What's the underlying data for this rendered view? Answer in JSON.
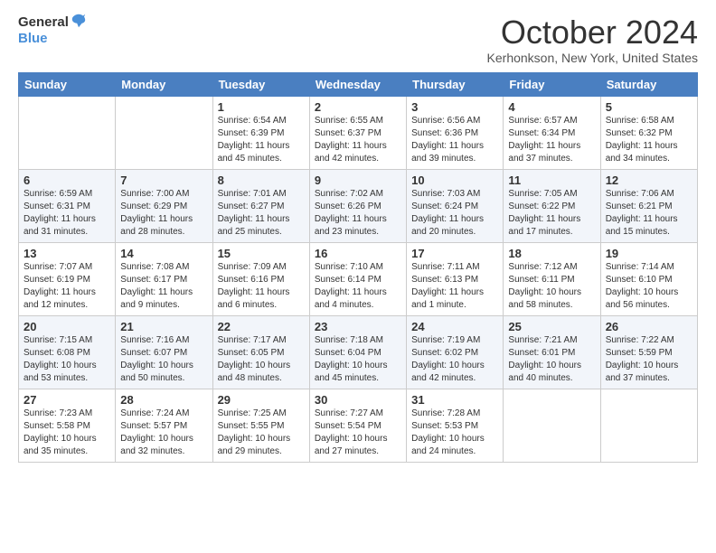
{
  "logo": {
    "line1": "General",
    "line2": "Blue"
  },
  "title": "October 2024",
  "subtitle": "Kerhonkson, New York, United States",
  "weekdays": [
    "Sunday",
    "Monday",
    "Tuesday",
    "Wednesday",
    "Thursday",
    "Friday",
    "Saturday"
  ],
  "weeks": [
    [
      {
        "day": "",
        "detail": ""
      },
      {
        "day": "",
        "detail": ""
      },
      {
        "day": "1",
        "detail": "Sunrise: 6:54 AM\nSunset: 6:39 PM\nDaylight: 11 hours and 45 minutes."
      },
      {
        "day": "2",
        "detail": "Sunrise: 6:55 AM\nSunset: 6:37 PM\nDaylight: 11 hours and 42 minutes."
      },
      {
        "day": "3",
        "detail": "Sunrise: 6:56 AM\nSunset: 6:36 PM\nDaylight: 11 hours and 39 minutes."
      },
      {
        "day": "4",
        "detail": "Sunrise: 6:57 AM\nSunset: 6:34 PM\nDaylight: 11 hours and 37 minutes."
      },
      {
        "day": "5",
        "detail": "Sunrise: 6:58 AM\nSunset: 6:32 PM\nDaylight: 11 hours and 34 minutes."
      }
    ],
    [
      {
        "day": "6",
        "detail": "Sunrise: 6:59 AM\nSunset: 6:31 PM\nDaylight: 11 hours and 31 minutes."
      },
      {
        "day": "7",
        "detail": "Sunrise: 7:00 AM\nSunset: 6:29 PM\nDaylight: 11 hours and 28 minutes."
      },
      {
        "day": "8",
        "detail": "Sunrise: 7:01 AM\nSunset: 6:27 PM\nDaylight: 11 hours and 25 minutes."
      },
      {
        "day": "9",
        "detail": "Sunrise: 7:02 AM\nSunset: 6:26 PM\nDaylight: 11 hours and 23 minutes."
      },
      {
        "day": "10",
        "detail": "Sunrise: 7:03 AM\nSunset: 6:24 PM\nDaylight: 11 hours and 20 minutes."
      },
      {
        "day": "11",
        "detail": "Sunrise: 7:05 AM\nSunset: 6:22 PM\nDaylight: 11 hours and 17 minutes."
      },
      {
        "day": "12",
        "detail": "Sunrise: 7:06 AM\nSunset: 6:21 PM\nDaylight: 11 hours and 15 minutes."
      }
    ],
    [
      {
        "day": "13",
        "detail": "Sunrise: 7:07 AM\nSunset: 6:19 PM\nDaylight: 11 hours and 12 minutes."
      },
      {
        "day": "14",
        "detail": "Sunrise: 7:08 AM\nSunset: 6:17 PM\nDaylight: 11 hours and 9 minutes."
      },
      {
        "day": "15",
        "detail": "Sunrise: 7:09 AM\nSunset: 6:16 PM\nDaylight: 11 hours and 6 minutes."
      },
      {
        "day": "16",
        "detail": "Sunrise: 7:10 AM\nSunset: 6:14 PM\nDaylight: 11 hours and 4 minutes."
      },
      {
        "day": "17",
        "detail": "Sunrise: 7:11 AM\nSunset: 6:13 PM\nDaylight: 11 hours and 1 minute."
      },
      {
        "day": "18",
        "detail": "Sunrise: 7:12 AM\nSunset: 6:11 PM\nDaylight: 10 hours and 58 minutes."
      },
      {
        "day": "19",
        "detail": "Sunrise: 7:14 AM\nSunset: 6:10 PM\nDaylight: 10 hours and 56 minutes."
      }
    ],
    [
      {
        "day": "20",
        "detail": "Sunrise: 7:15 AM\nSunset: 6:08 PM\nDaylight: 10 hours and 53 minutes."
      },
      {
        "day": "21",
        "detail": "Sunrise: 7:16 AM\nSunset: 6:07 PM\nDaylight: 10 hours and 50 minutes."
      },
      {
        "day": "22",
        "detail": "Sunrise: 7:17 AM\nSunset: 6:05 PM\nDaylight: 10 hours and 48 minutes."
      },
      {
        "day": "23",
        "detail": "Sunrise: 7:18 AM\nSunset: 6:04 PM\nDaylight: 10 hours and 45 minutes."
      },
      {
        "day": "24",
        "detail": "Sunrise: 7:19 AM\nSunset: 6:02 PM\nDaylight: 10 hours and 42 minutes."
      },
      {
        "day": "25",
        "detail": "Sunrise: 7:21 AM\nSunset: 6:01 PM\nDaylight: 10 hours and 40 minutes."
      },
      {
        "day": "26",
        "detail": "Sunrise: 7:22 AM\nSunset: 5:59 PM\nDaylight: 10 hours and 37 minutes."
      }
    ],
    [
      {
        "day": "27",
        "detail": "Sunrise: 7:23 AM\nSunset: 5:58 PM\nDaylight: 10 hours and 35 minutes."
      },
      {
        "day": "28",
        "detail": "Sunrise: 7:24 AM\nSunset: 5:57 PM\nDaylight: 10 hours and 32 minutes."
      },
      {
        "day": "29",
        "detail": "Sunrise: 7:25 AM\nSunset: 5:55 PM\nDaylight: 10 hours and 29 minutes."
      },
      {
        "day": "30",
        "detail": "Sunrise: 7:27 AM\nSunset: 5:54 PM\nDaylight: 10 hours and 27 minutes."
      },
      {
        "day": "31",
        "detail": "Sunrise: 7:28 AM\nSunset: 5:53 PM\nDaylight: 10 hours and 24 minutes."
      },
      {
        "day": "",
        "detail": ""
      },
      {
        "day": "",
        "detail": ""
      }
    ]
  ]
}
